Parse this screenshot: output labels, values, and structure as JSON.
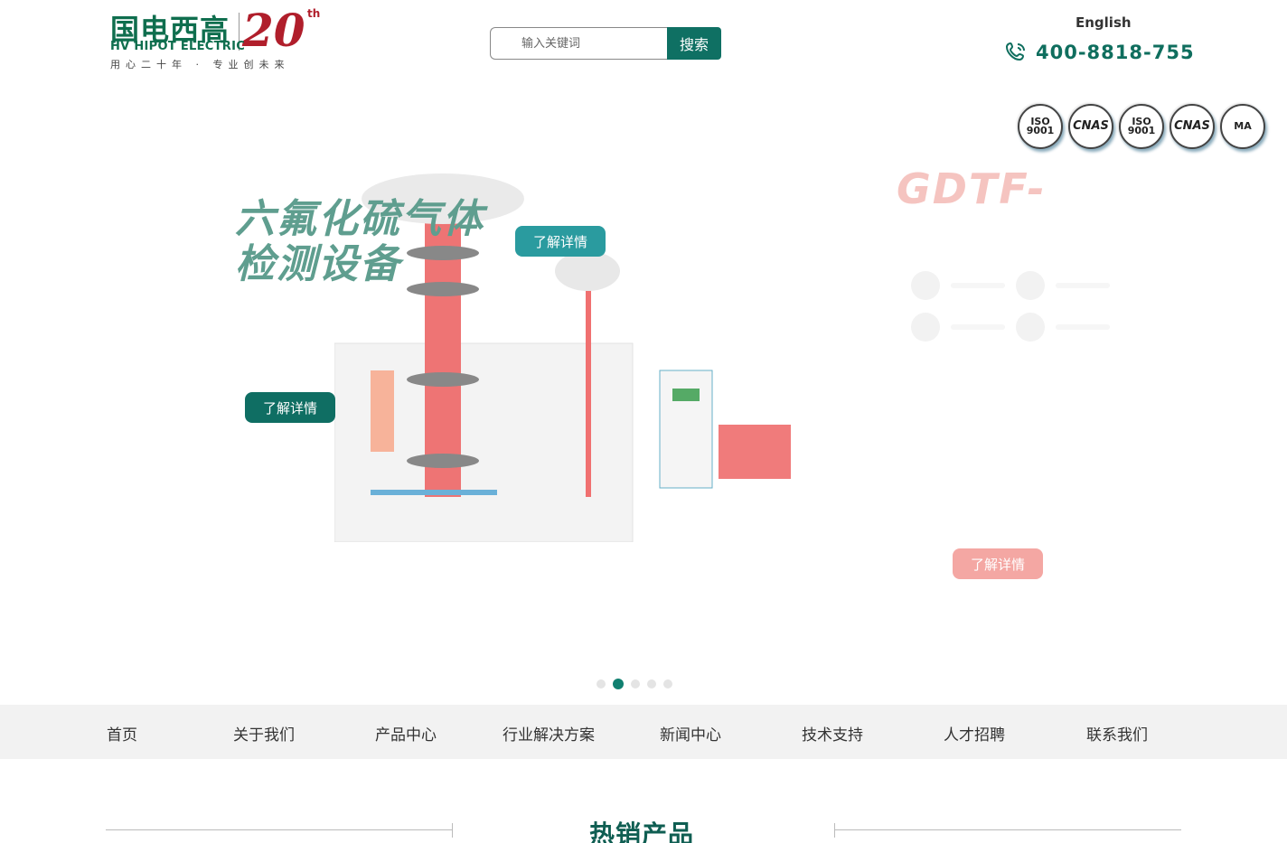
{
  "header": {
    "logo_cn": "国电西高",
    "logo_en": "HV HIPOT ELECTRIC",
    "logo_slogan": "用心二十年 · 专业创未来",
    "logo_anniv": "20",
    "logo_anniv_sup": "th",
    "search_placeholder": "输入关键词",
    "search_button": "搜索",
    "language": "English",
    "phone": "400-8818-755",
    "certifications": [
      "ISO 9001",
      "CNAS",
      "ISO 9001",
      "CNAS",
      "MA"
    ]
  },
  "banner": {
    "title_line1": "六氟化硫气体",
    "title_line2": "检测设备",
    "detail_button": "了解详情",
    "side_title": "GDTF-",
    "slide_count": 5,
    "active_slide": 2
  },
  "nav": {
    "items": [
      "首页",
      "关于我们",
      "产品中心",
      "行业解决方案",
      "新闻中心",
      "技术支持",
      "人才招聘",
      "联系我们"
    ]
  },
  "section": {
    "title": "热销产品"
  },
  "colors": {
    "brand_green": "#0f6e4e",
    "button_teal": "#0f7063",
    "anniv_red": "#b01e2b",
    "nav_bg": "#f2f2f2",
    "pink_button": "#f4a7a3"
  }
}
